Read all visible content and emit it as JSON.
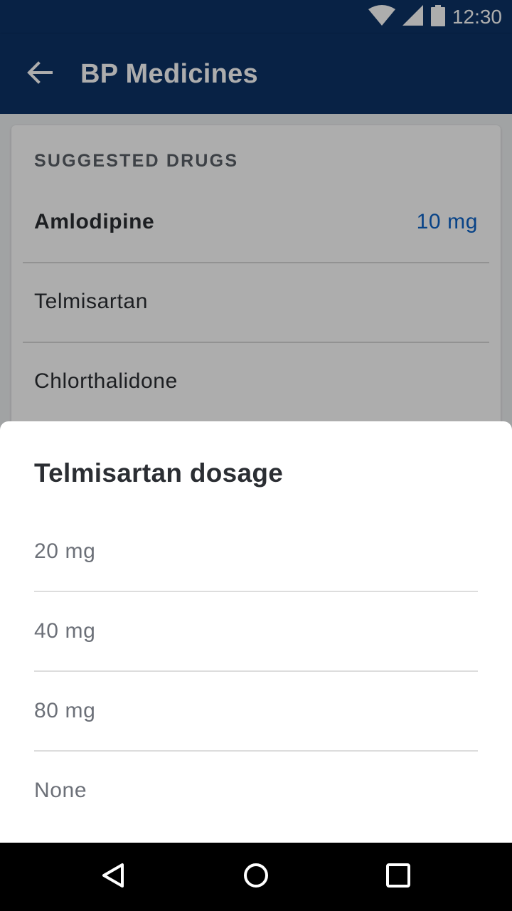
{
  "status_bar": {
    "time": "12:30",
    "icons": [
      "wifi-icon",
      "signal-icon",
      "battery-icon"
    ]
  },
  "app_bar": {
    "back_icon": "arrow-left-icon",
    "title": "BP Medicines"
  },
  "card": {
    "header": "SUGGESTED DRUGS",
    "drugs": [
      {
        "name": "Amlodipine",
        "dose": "10 mg",
        "selected": true
      },
      {
        "name": "Telmisartan",
        "dose": "",
        "selected": false
      },
      {
        "name": "Chlorthalidone",
        "dose": "",
        "selected": false
      }
    ]
  },
  "sheet": {
    "title": "Telmisartan dosage",
    "options": [
      "20 mg",
      "40 mg",
      "80 mg",
      "None"
    ]
  },
  "nav_bar": {
    "icons": [
      "back-triangle-icon",
      "home-circle-icon",
      "recents-square-icon"
    ]
  },
  "colors": {
    "primary": "#0c3366",
    "accent": "#0d63c8",
    "text_primary": "#2b2e33",
    "text_secondary": "#6c7078"
  }
}
